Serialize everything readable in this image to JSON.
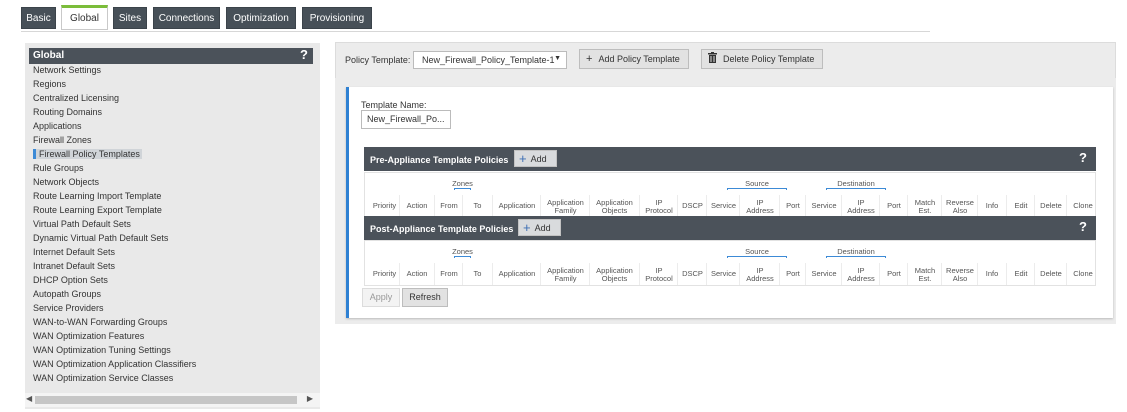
{
  "tabs": [
    {
      "label": "Basic"
    },
    {
      "label": "Global"
    },
    {
      "label": "Sites"
    },
    {
      "label": "Connections"
    },
    {
      "label": "Optimization"
    },
    {
      "label": "Provisioning"
    }
  ],
  "sidebar": {
    "title": "Global",
    "help": "?",
    "selected": "Firewall Policy Templates",
    "items": [
      "Network Settings",
      "Regions",
      "Centralized Licensing",
      "Routing Domains",
      "Applications",
      "Firewall Zones",
      "Firewall Policy Templates",
      "Rule Groups",
      "Network Objects",
      "Route Learning Import Template",
      "Route Learning Export Template",
      "Virtual Path Default Sets",
      "Dynamic Virtual Path Default Sets",
      "Internet Default Sets",
      "Intranet Default Sets",
      "DHCP Option Sets",
      "Autopath Groups",
      "Service Providers",
      "WAN-to-WAN Forwarding Groups",
      "WAN Optimization Features",
      "WAN Optimization Tuning Settings",
      "WAN Optimization Application Classifiers",
      "WAN Optimization Service Classes"
    ]
  },
  "toolbar": {
    "policy_template_label": "Policy Template:",
    "policy_template_value": "New_Firewall_Policy_Template-1",
    "add_label": "Add Policy Template",
    "delete_label": "Delete Policy Template"
  },
  "template": {
    "name_label": "Template Name:",
    "name_value": "New_Firewall_Po..."
  },
  "sections": [
    {
      "title": "Pre-Appliance Template Policies",
      "add_label": "Add",
      "help": "?"
    },
    {
      "title": "Post-Appliance Template Policies",
      "add_label": "Add",
      "help": "?"
    }
  ],
  "groups": {
    "zones": "Zones",
    "source": "Source",
    "destination": "Destination"
  },
  "columns": [
    [
      "Priority"
    ],
    [
      "Action"
    ],
    [
      "From"
    ],
    [
      "To"
    ],
    [
      "Application"
    ],
    [
      "Application",
      "Family"
    ],
    [
      "Application",
      "Objects"
    ],
    [
      "IP",
      "Protocol"
    ],
    [
      "DSCP"
    ],
    [
      "Service"
    ],
    [
      "IP",
      "Address"
    ],
    [
      "Port"
    ],
    [
      "Service"
    ],
    [
      "IP",
      "Address"
    ],
    [
      "Port"
    ],
    [
      "Match",
      "Est."
    ],
    [
      "Reverse",
      "Also"
    ],
    [
      "Info"
    ],
    [
      "Edit"
    ],
    [
      "Delete"
    ],
    [
      "Clone"
    ]
  ],
  "buttons": {
    "apply": "Apply",
    "refresh": "Refresh"
  },
  "colors": {
    "tab_bg": "#475058",
    "tab_active_accent": "#7bbd3a",
    "header_bg": "#4b525a",
    "accent_blue": "#2f81d3"
  }
}
